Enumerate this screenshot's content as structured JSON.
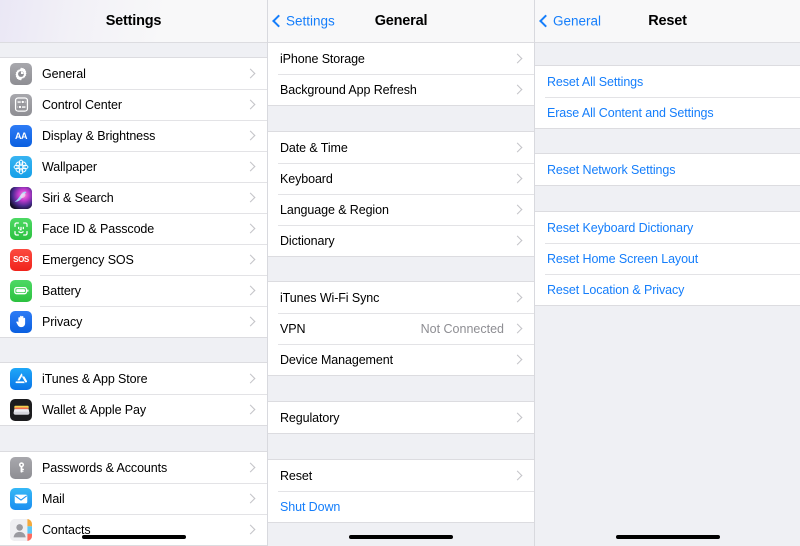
{
  "panels": [
    {
      "id": "settings",
      "navbar": {
        "title": "Settings",
        "back": null,
        "tinted": true
      },
      "groups": [
        {
          "top_gap": 14,
          "rows": [
            {
              "label": "General",
              "icon": "gear-icon",
              "icon_class": "ico-general",
              "chevron": true
            },
            {
              "label": "Control Center",
              "icon": "sliders-icon",
              "icon_class": "ico-control",
              "chevron": true
            },
            {
              "label": "Display & Brightness",
              "icon": "text-size-icon",
              "icon_class": "ico-display",
              "chevron": true
            },
            {
              "label": "Wallpaper",
              "icon": "flower-icon",
              "icon_class": "ico-wallpaper",
              "chevron": true
            },
            {
              "label": "Siri & Search",
              "icon": "siri-icon",
              "icon_class": "ico-siri",
              "chevron": true
            },
            {
              "label": "Face ID & Passcode",
              "icon": "face-id-icon",
              "icon_class": "ico-faceid",
              "chevron": true
            },
            {
              "label": "Emergency SOS",
              "icon": "sos-icon",
              "icon_class": "ico-sos",
              "chevron": true
            },
            {
              "label": "Battery",
              "icon": "battery-icon",
              "icon_class": "ico-battery",
              "chevron": true
            },
            {
              "label": "Privacy",
              "icon": "hand-icon",
              "icon_class": "ico-privacy",
              "chevron": true
            }
          ]
        },
        {
          "top_gap": 24,
          "rows": [
            {
              "label": "iTunes & App Store",
              "icon": "app-store-icon",
              "icon_class": "ico-itunes",
              "chevron": true
            },
            {
              "label": "Wallet & Apple Pay",
              "icon": "wallet-icon",
              "icon_class": "ico-wallet",
              "chevron": true
            }
          ]
        },
        {
          "top_gap": 25,
          "rows": [
            {
              "label": "Passwords & Accounts",
              "icon": "key-icon",
              "icon_class": "ico-passwords",
              "chevron": true
            },
            {
              "label": "Mail",
              "icon": "envelope-icon",
              "icon_class": "ico-mail",
              "chevron": true
            },
            {
              "label": "Contacts",
              "icon": "contacts-icon",
              "icon_class": "ico-contacts",
              "chevron": true
            }
          ]
        }
      ]
    },
    {
      "id": "general",
      "navbar": {
        "title": "General",
        "back": "Settings",
        "tinted": false
      },
      "groups": [
        {
          "top_gap": 0,
          "rows": [
            {
              "label": "iPhone Storage",
              "chevron": true
            },
            {
              "label": "Background App Refresh",
              "chevron": true
            }
          ]
        },
        {
          "top_gap": 25,
          "rows": [
            {
              "label": "Date & Time",
              "chevron": true
            },
            {
              "label": "Keyboard",
              "chevron": true
            },
            {
              "label": "Language & Region",
              "chevron": true
            },
            {
              "label": "Dictionary",
              "chevron": true
            }
          ]
        },
        {
          "top_gap": 24,
          "rows": [
            {
              "label": "iTunes Wi-Fi Sync",
              "chevron": true
            },
            {
              "label": "VPN",
              "detail": "Not Connected",
              "chevron": true
            },
            {
              "label": "Device Management",
              "chevron": true
            }
          ]
        },
        {
          "top_gap": 25,
          "rows": [
            {
              "label": "Regulatory",
              "chevron": true
            }
          ]
        },
        {
          "top_gap": 25,
          "rows": [
            {
              "label": "Reset",
              "chevron": true
            },
            {
              "label": "Shut Down",
              "link": true,
              "chevron": false
            }
          ]
        }
      ]
    },
    {
      "id": "reset",
      "navbar": {
        "title": "Reset",
        "back": "General",
        "tinted": false
      },
      "groups": [
        {
          "top_gap": 22,
          "rows": [
            {
              "label": "Reset All Settings",
              "link": true,
              "chevron": false
            },
            {
              "label": "Erase All Content and Settings",
              "link": true,
              "chevron": false
            }
          ]
        },
        {
          "top_gap": 24,
          "rows": [
            {
              "label": "Reset Network Settings",
              "link": true,
              "chevron": false
            }
          ]
        },
        {
          "top_gap": 25,
          "rows": [
            {
              "label": "Reset Keyboard Dictionary",
              "link": true,
              "chevron": false
            },
            {
              "label": "Reset Home Screen Layout",
              "link": true,
              "chevron": false
            },
            {
              "label": "Reset Location & Privacy",
              "link": true,
              "chevron": false
            }
          ]
        }
      ]
    }
  ],
  "colors": {
    "accent": "#157efb",
    "background": "#eff0f4",
    "row_background": "#ffffff",
    "separator": "#e3e3e6",
    "detail_text": "#8e8e93",
    "navbar": "#f8f8f9"
  },
  "home_indicator": {
    "visible": true
  }
}
